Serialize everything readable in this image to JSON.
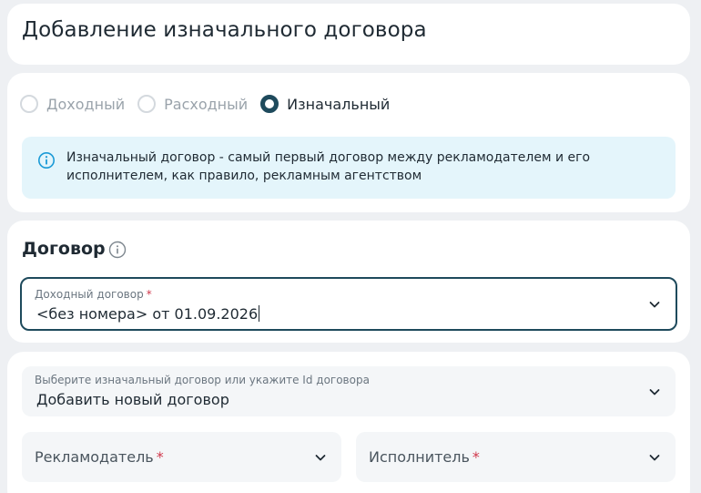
{
  "page": {
    "title": "Добавление изначального договора"
  },
  "contract_type": {
    "options": [
      {
        "label": "Доходный",
        "selected": false
      },
      {
        "label": "Расходный",
        "selected": false
      },
      {
        "label": "Изначальный",
        "selected": true
      }
    ],
    "info_text": "Изначальный договор - самый первый договор между рекламодателем и его исполнителем, как правило, рекламным агентством"
  },
  "contract_section": {
    "title": "Договор",
    "income_contract": {
      "label": "Доходный договор",
      "required_mark": "*",
      "value": "<без номера> от 01.09.2026"
    }
  },
  "original_section": {
    "select": {
      "label": "Выберите изначальный договор или укажите Id договора",
      "value": "Добавить новый договор"
    },
    "advertiser": {
      "placeholder": "Рекламодатель",
      "required_mark": "*"
    },
    "executor": {
      "placeholder": "Исполнитель",
      "required_mark": "*"
    }
  },
  "colors": {
    "accent": "#1e4a5c",
    "info_bg": "#e4f5fb",
    "info_icon": "#1a9ad6",
    "required": "#d0374b",
    "page_bg": "#eef0f3"
  },
  "icons": {
    "info": "info-icon",
    "help": "help-circle-icon",
    "chevron": "chevron-down-icon"
  }
}
